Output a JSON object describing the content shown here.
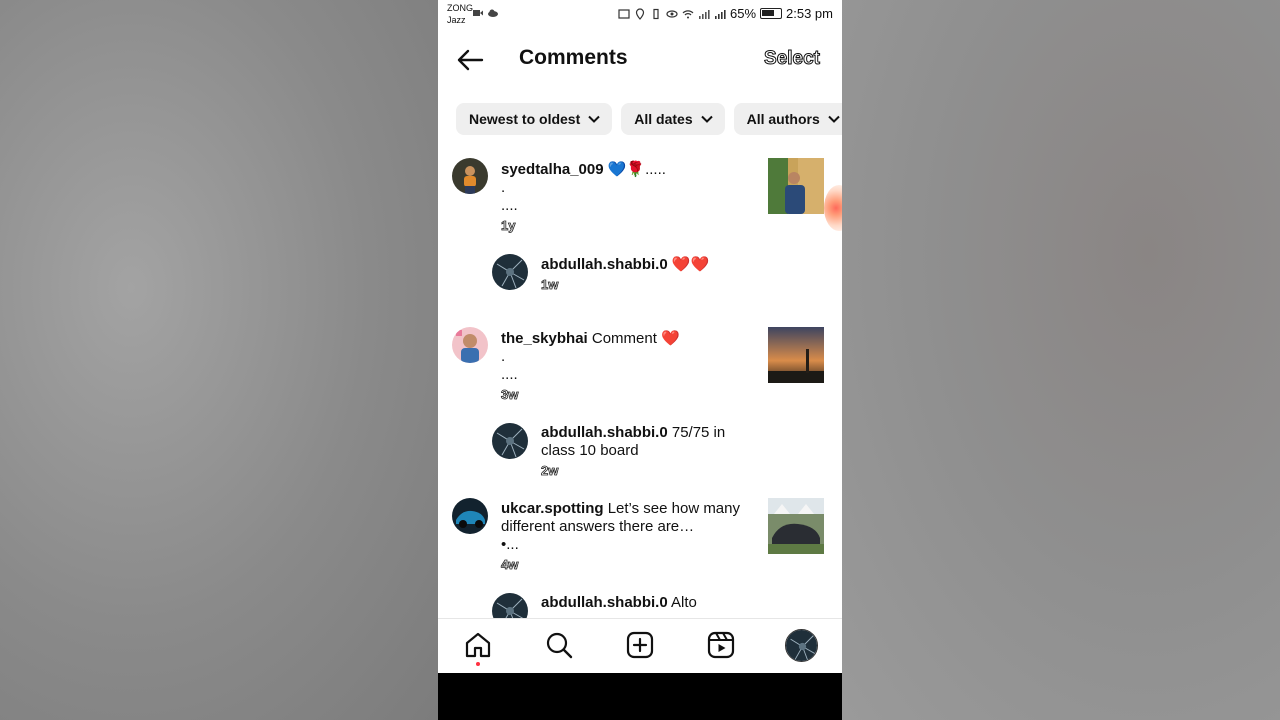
{
  "status_bar": {
    "carrier_line1": "ZONG",
    "carrier_line2": "Jazz",
    "battery": "65%",
    "time": "2:53 pm"
  },
  "header": {
    "title": "Comments",
    "select_label": "Select"
  },
  "filters": [
    {
      "label": "Newest to oldest"
    },
    {
      "label": "All dates"
    },
    {
      "label": "All authors"
    }
  ],
  "comments": [
    {
      "username": "syedtalha_009",
      "text": " 💙🌹.....",
      "line2": ".",
      "line3": "....",
      "time": "1y"
    },
    {
      "username": "abdullah.shabbi.0",
      "text": " ❤️❤️",
      "time": "1w"
    },
    {
      "username": "the_skybhai",
      "text": " Comment ❤️",
      "line2": ".",
      "line3": "....",
      "time": "3w"
    },
    {
      "username": "abdullah.shabbi.0",
      "text": " 75/75 in class 10 board",
      "time": "2w"
    },
    {
      "username": "ukcar.spotting",
      "text": " Let’s see how many different answers there are…",
      "line2": "•...",
      "time": "4w"
    },
    {
      "username": "abdullah.shabbi.0",
      "text": " Alto"
    }
  ],
  "nav": [
    "home-icon",
    "search-icon",
    "create-icon",
    "reels-icon",
    "profile-avatar"
  ],
  "colors": {
    "accent_dot": "#ff3040",
    "chip_bg": "#efefef"
  }
}
